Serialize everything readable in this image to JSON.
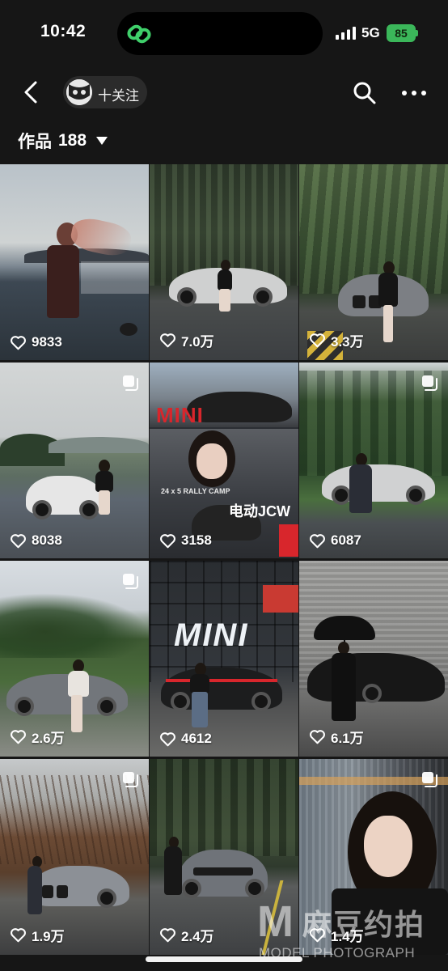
{
  "status_bar": {
    "time": "10:42",
    "network": "5G",
    "battery": "85"
  },
  "header": {
    "follow_label": "十关注",
    "icons": [
      "back-chevron-icon",
      "avatar",
      "search-icon",
      "more-icon"
    ]
  },
  "works": {
    "title": "作品",
    "count": "188"
  },
  "grid": [
    {
      "likes": "9833",
      "multi": false
    },
    {
      "likes": "7.0万",
      "multi": false
    },
    {
      "likes": "3.3万",
      "multi": false
    },
    {
      "likes": "8038",
      "multi": true
    },
    {
      "likes": "3158",
      "multi": false,
      "overlay_top": "MINI",
      "overlay_bottom": "电动JCW",
      "overlay_small": "24 x 5 RALLY CAMP"
    },
    {
      "likes": "6087",
      "multi": true
    },
    {
      "likes": "2.6万",
      "multi": true
    },
    {
      "likes": "4612",
      "multi": false,
      "overlay_top": "MINI"
    },
    {
      "likes": "6.1万",
      "multi": false
    },
    {
      "likes": "1.9万",
      "multi": true
    },
    {
      "likes": "2.4万",
      "multi": false
    },
    {
      "likes": "1.4万",
      "multi": true
    }
  ],
  "watermark": {
    "mark": "M",
    "cn": "麻豆约拍",
    "en": "MODEL PHOTOGRAPH"
  },
  "colors": {
    "background": "#161616",
    "battery_green": "#3bb75a",
    "mini_red": "#d8262c"
  }
}
